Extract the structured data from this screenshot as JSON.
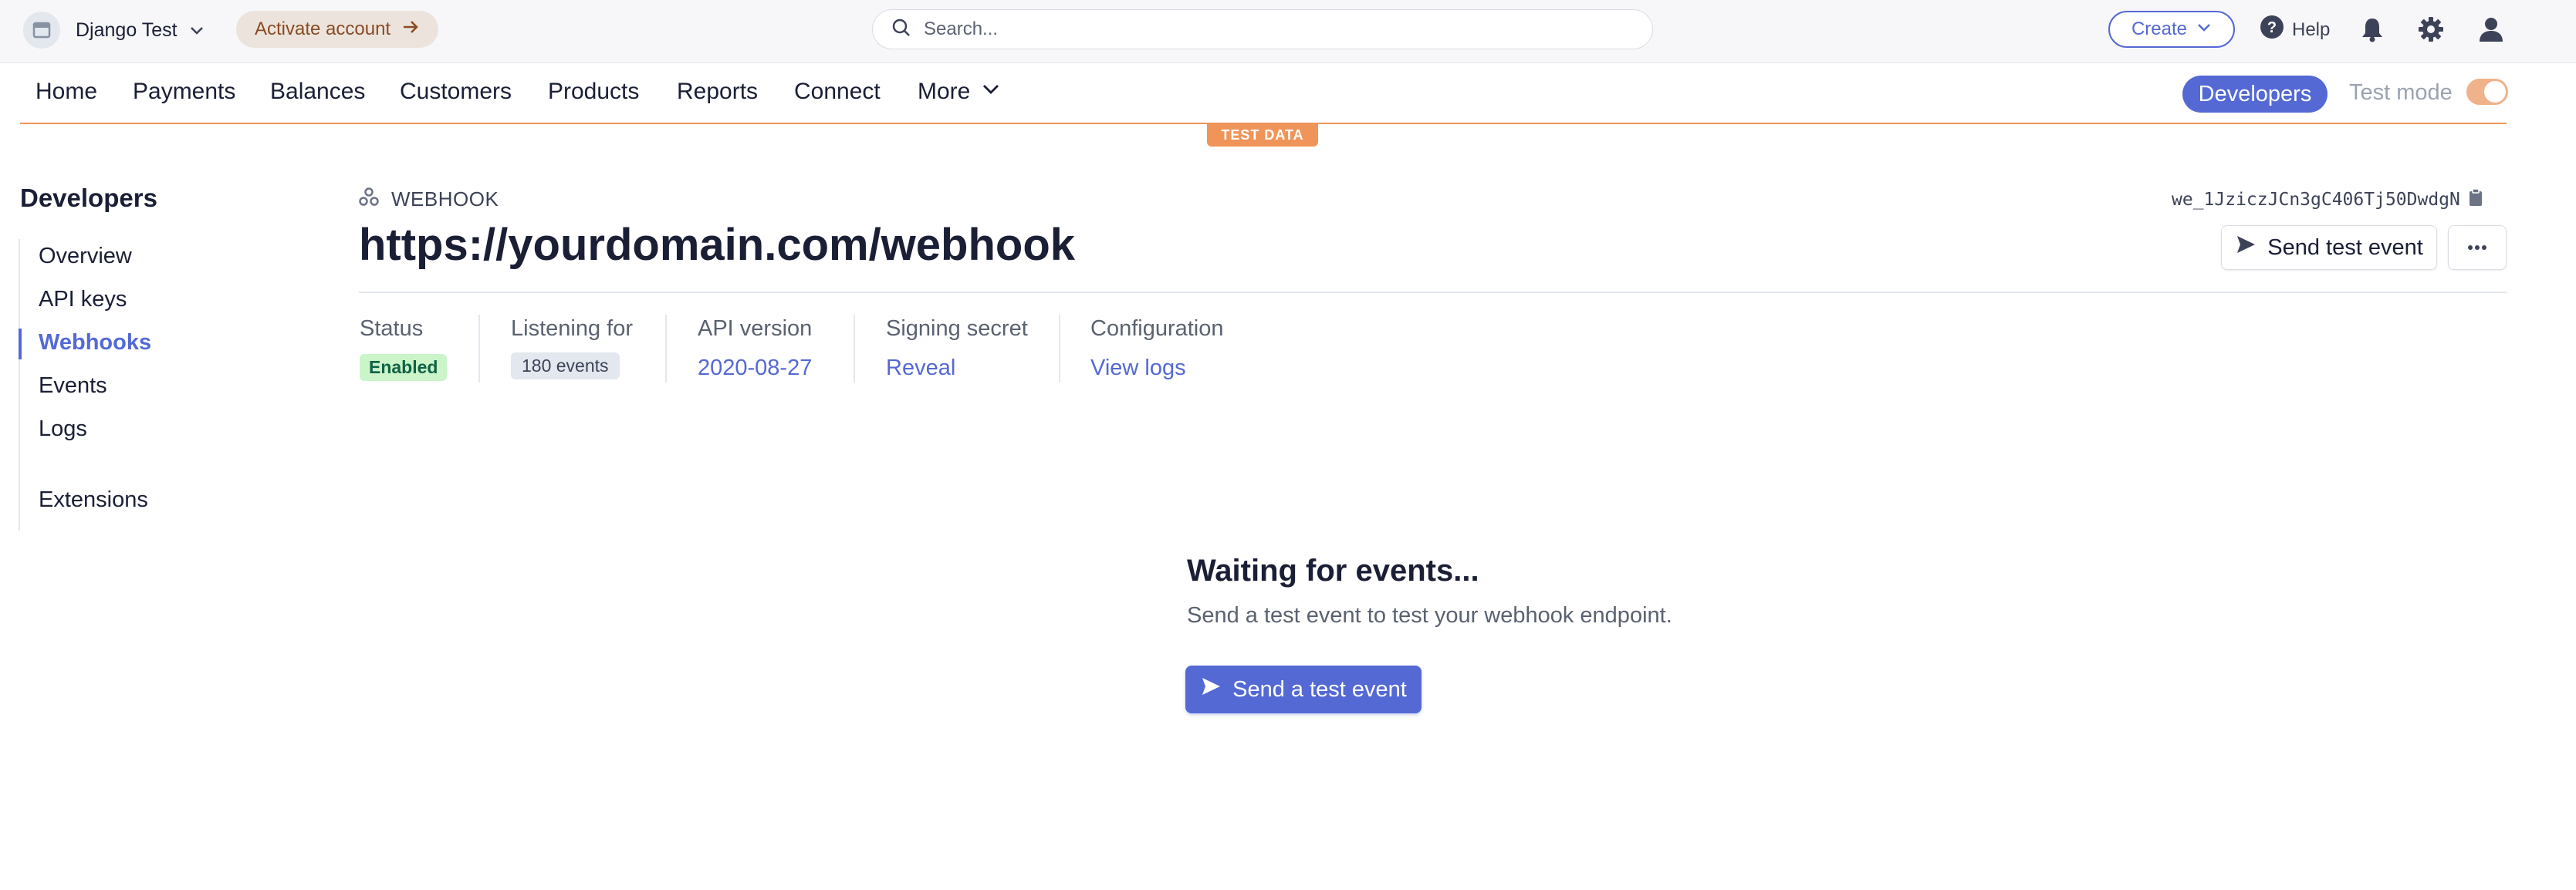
{
  "topbar": {
    "account_name": "Django Test",
    "activate_label": "Activate account",
    "search_placeholder": "Search...",
    "create_label": "Create",
    "help_label": "Help"
  },
  "nav": {
    "items": [
      "Home",
      "Payments",
      "Balances",
      "Customers",
      "Products",
      "Reports",
      "Connect",
      "More"
    ],
    "developers_label": "Developers",
    "test_mode_label": "Test mode",
    "test_mode_on": true,
    "test_data_banner": "TEST DATA"
  },
  "sidebar": {
    "title": "Developers",
    "items": [
      {
        "label": "Overview",
        "active": false
      },
      {
        "label": "API keys",
        "active": false
      },
      {
        "label": "Webhooks",
        "active": true
      },
      {
        "label": "Events",
        "active": false
      },
      {
        "label": "Logs",
        "active": false
      },
      {
        "label": "Extensions",
        "active": false
      }
    ]
  },
  "webhook": {
    "section_label": "WEBHOOK",
    "id": "we_1JziczJCn3gC406Tj50DwdgN",
    "url": "https://yourdomain.com/webhook",
    "send_test_label": "Send test event",
    "meta": {
      "status_label": "Status",
      "status_value": "Enabled",
      "listening_label": "Listening for",
      "listening_value": "180 events",
      "api_version_label": "API version",
      "api_version_value": "2020-08-27",
      "signing_label": "Signing secret",
      "signing_value": "Reveal",
      "config_label": "Configuration",
      "config_value": "View logs"
    }
  },
  "empty_state": {
    "title": "Waiting for events...",
    "subtitle": "Send a test event to test your webhook endpoint.",
    "button_label": "Send a test event"
  },
  "colors": {
    "accent": "#5469d4",
    "test_orange": "#f0955a",
    "enabled_bg": "#cbf4c9",
    "enabled_text": "#0e6245"
  }
}
